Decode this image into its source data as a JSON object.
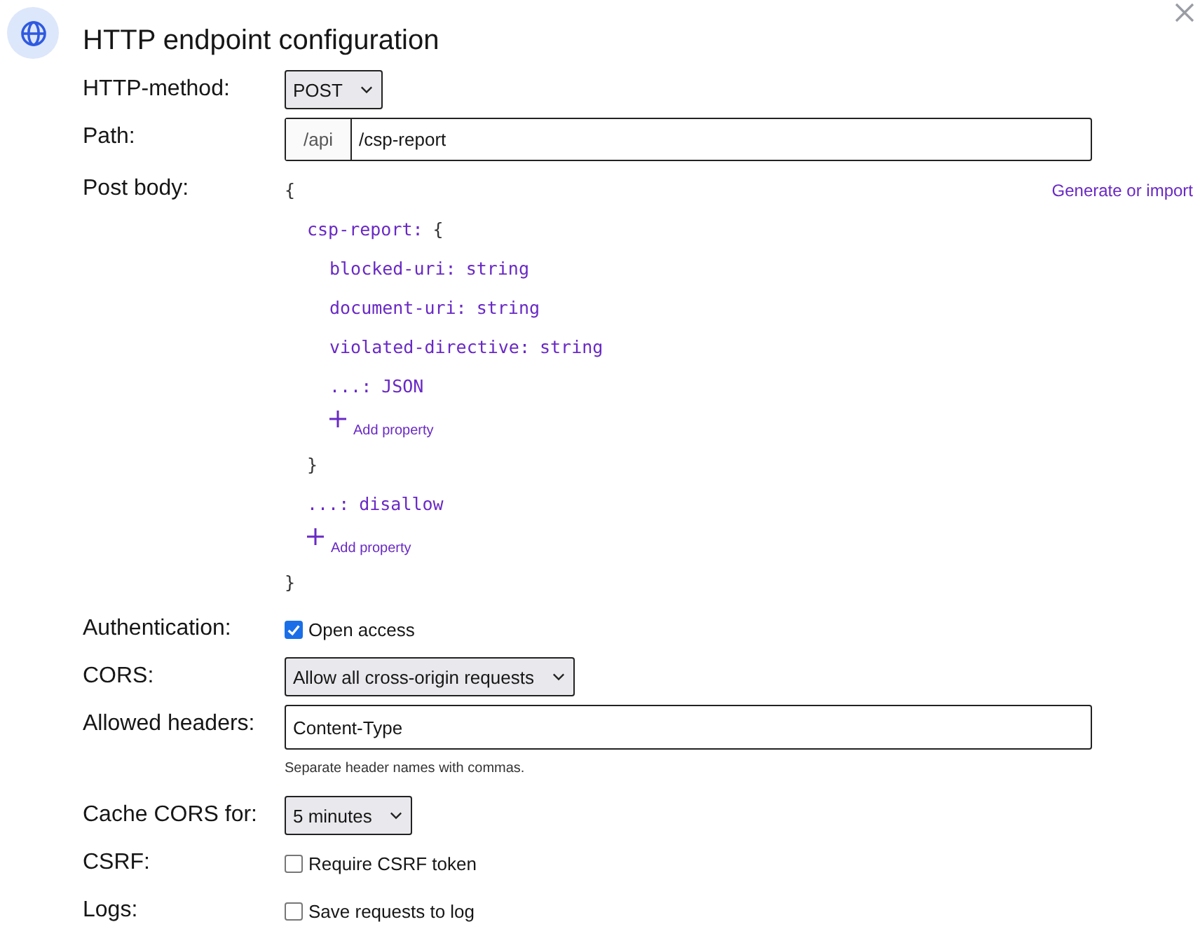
{
  "dialog": {
    "title": "HTTP endpoint configuration"
  },
  "fields": [
    {
      "kind": "select",
      "label": "HTTP-method:",
      "value": "POST"
    },
    {
      "kind": "path",
      "label": "Path:",
      "prefix": "/api",
      "value": "/csp-report"
    },
    {
      "kind": "body",
      "label": "Post body:",
      "action": "Generate or import",
      "body": {
        "open": "{",
        "close": "}",
        "add_label": "Add property",
        "entries": [
          {
            "key": "csp-report:",
            "object": {
              "open": "{",
              "close": "}",
              "add_label": "Add property",
              "entries": [
                {
                  "key": "blocked-uri:",
                  "value": "string"
                },
                {
                  "key": "document-uri:",
                  "value": "string"
                },
                {
                  "key": "violated-directive:",
                  "value": "string"
                },
                {
                  "key": "...:",
                  "value": "JSON"
                }
              ]
            }
          },
          {
            "key": "...:",
            "value": "disallow"
          }
        ]
      }
    },
    {
      "kind": "checkbox",
      "label": "Authentication:",
      "text": "Open access",
      "checked": true
    },
    {
      "kind": "select",
      "label": "CORS:",
      "value": "Allow all cross-origin requests"
    },
    {
      "kind": "text",
      "label": "Allowed headers:",
      "value": "Content-Type",
      "hint": "Separate header names with commas."
    },
    {
      "kind": "select",
      "label": "Cache CORS for:",
      "value": "5 minutes"
    },
    {
      "kind": "checkbox",
      "label": "CSRF:",
      "text": "Require CSRF token",
      "checked": false
    },
    {
      "kind": "checkbox",
      "label": "Logs:",
      "text": "Save requests to log",
      "checked": false
    }
  ]
}
